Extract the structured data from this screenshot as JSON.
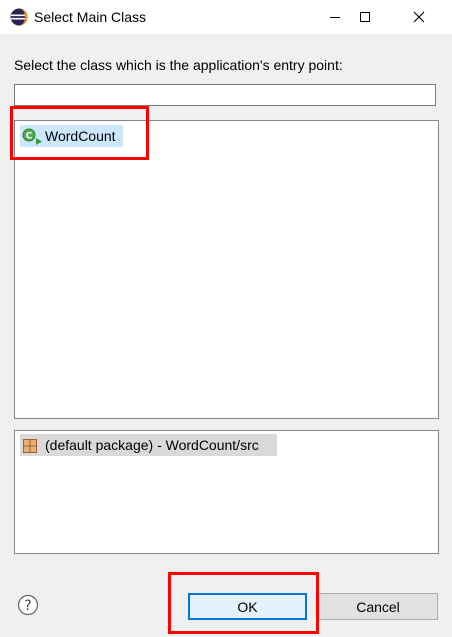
{
  "window": {
    "title": "Select Main Class",
    "icon": "eclipse-icon"
  },
  "dialog": {
    "prompt": "Select the class which is the application's entry point:",
    "filter": {
      "value": "",
      "placeholder": ""
    },
    "classes": [
      {
        "label": "WordCount",
        "icon": "java-class-main-icon",
        "selected": true
      }
    ],
    "packages": [
      {
        "label": "(default package) - WordCount/src",
        "icon": "package-icon"
      }
    ]
  },
  "buttons": {
    "ok_label": "OK",
    "cancel_label": "Cancel",
    "help_icon": "help-icon"
  },
  "annotations": {
    "highlight_color": "#ff0000"
  },
  "colors": {
    "selection": "#cce8ff",
    "ok_border": "#0078d7"
  }
}
